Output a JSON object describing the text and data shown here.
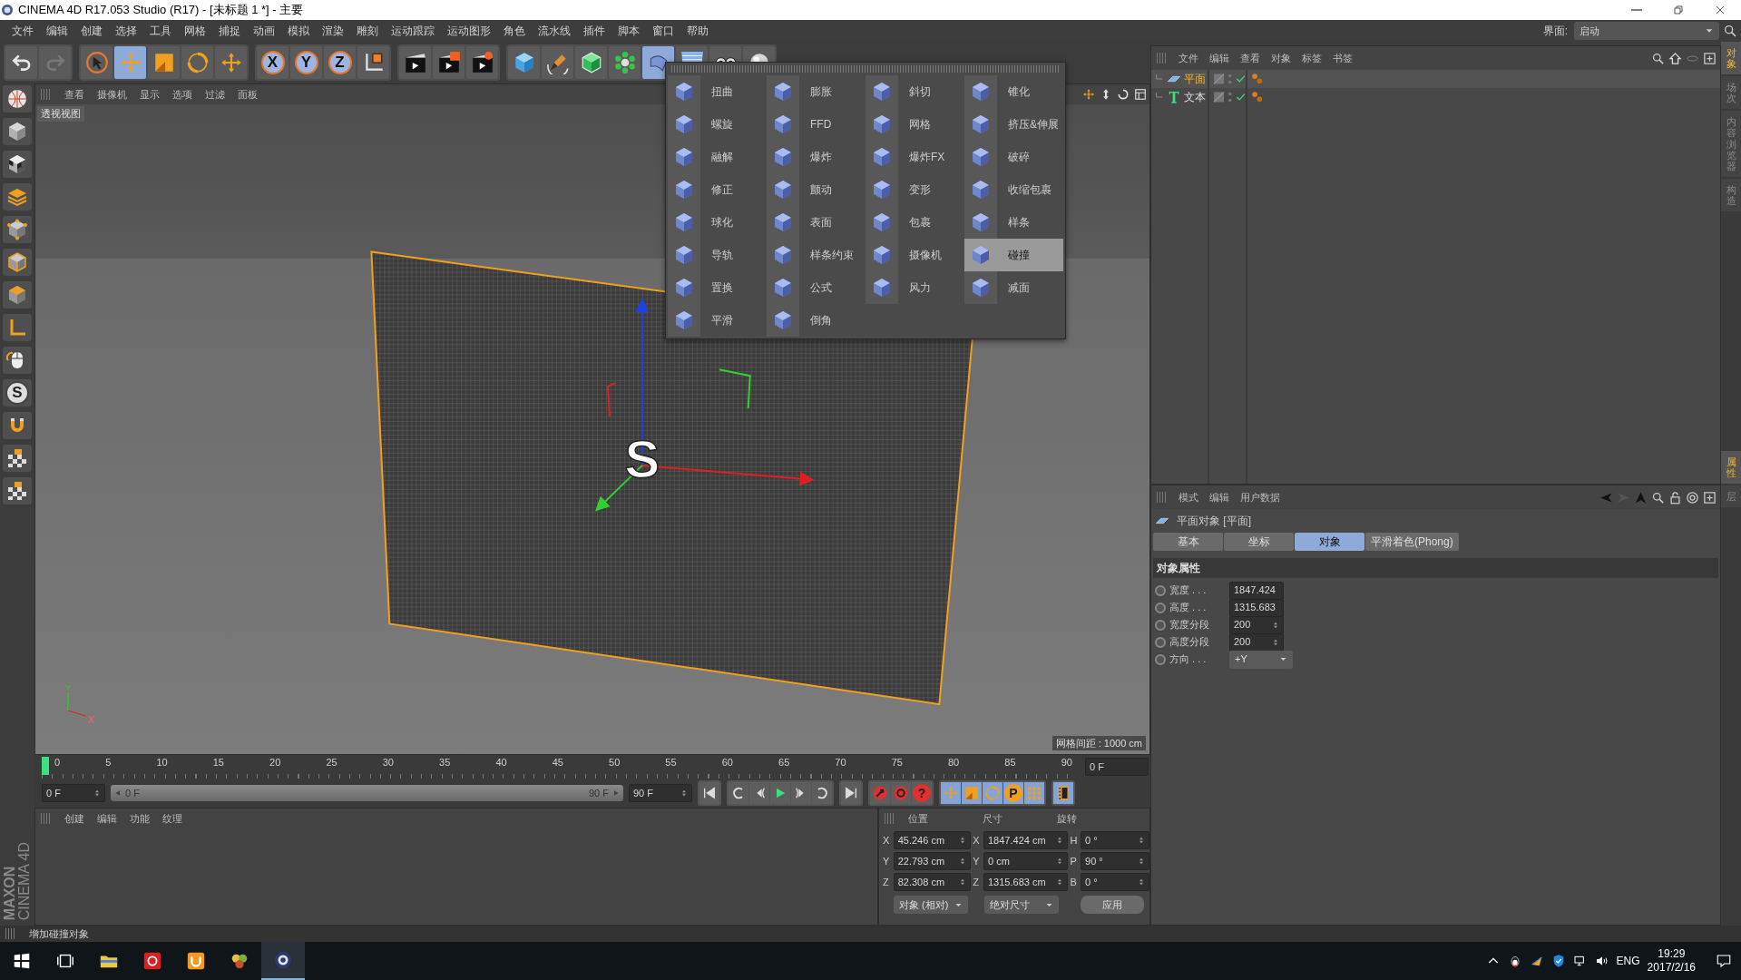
{
  "window": {
    "title": "CINEMA 4D R17.053 Studio (R17) - [未标题 1 *] - 主要"
  },
  "menu": [
    "文件",
    "编辑",
    "创建",
    "选择",
    "工具",
    "网格",
    "捕捉",
    "动画",
    "模拟",
    "渲染",
    "雕刻",
    "运动跟踪",
    "运动图形",
    "角色",
    "流水线",
    "插件",
    "脚本",
    "窗口",
    "帮助"
  ],
  "layout": {
    "label": "界面:",
    "value": "启动"
  },
  "toolbar": [
    [
      {
        "kind": "undo",
        "active": false
      },
      {
        "kind": "redo",
        "active": false
      }
    ],
    [
      {
        "kind": "select",
        "active": false
      },
      {
        "kind": "move",
        "active": true
      },
      {
        "kind": "scale",
        "active": false
      },
      {
        "kind": "rotate",
        "active": false
      },
      {
        "kind": "transform",
        "active": false
      }
    ],
    [
      {
        "kind": "axis",
        "label": "X",
        "active": false
      },
      {
        "kind": "axis",
        "label": "Y",
        "active": false
      },
      {
        "kind": "axis",
        "label": "Z",
        "active": false
      },
      {
        "kind": "coords",
        "active": false
      }
    ],
    [
      {
        "kind": "render_view",
        "active": false
      },
      {
        "kind": "render_picture",
        "active": false
      },
      {
        "kind": "render_settings",
        "active": false
      }
    ],
    [
      {
        "kind": "cube",
        "active": false
      },
      {
        "kind": "pen",
        "active": false
      },
      {
        "kind": "subdivision",
        "active": false
      },
      {
        "kind": "cloner",
        "active": false
      },
      {
        "kind": "deformer",
        "active": true
      },
      {
        "kind": "floor",
        "active": false
      },
      {
        "kind": "camera",
        "active": false
      },
      {
        "kind": "light",
        "active": false
      }
    ]
  ],
  "left_toolbar": [
    {
      "kind": "globe"
    },
    {
      "kind": "model"
    },
    {
      "kind": "texture"
    },
    {
      "kind": "workplane"
    },
    {
      "kind": "points"
    },
    {
      "kind": "edges"
    },
    {
      "kind": "polygons"
    },
    {
      "kind": "axis"
    },
    {
      "kind": "tweak"
    },
    {
      "kind": "snap",
      "label": "S"
    },
    {
      "kind": "magnet"
    },
    {
      "kind": "lock"
    },
    {
      "kind": "lock"
    }
  ],
  "logo": {
    "brand": "MAXON",
    "product": "CINEMA 4D"
  },
  "deformer_menu": {
    "columns": [
      [
        {
          "label": "扭曲",
          "selected": false
        },
        {
          "label": "螺旋",
          "selected": false
        },
        {
          "label": "融解",
          "selected": false
        },
        {
          "label": "修正",
          "selected": false
        },
        {
          "label": "球化",
          "selected": false
        },
        {
          "label": "导轨",
          "selected": false
        },
        {
          "label": "置换",
          "selected": false
        },
        {
          "label": "平滑",
          "selected": false
        }
      ],
      [
        {
          "label": "膨胀",
          "selected": false
        },
        {
          "label": "FFD",
          "selected": false
        },
        {
          "label": "爆炸",
          "selected": false
        },
        {
          "label": "颤动",
          "selected": false
        },
        {
          "label": "表面",
          "selected": false
        },
        {
          "label": "样条约束",
          "selected": false
        },
        {
          "label": "公式",
          "selected": false
        },
        {
          "label": "倒角",
          "selected": false
        }
      ],
      [
        {
          "label": "斜切",
          "selected": false
        },
        {
          "label": "网格",
          "selected": false
        },
        {
          "label": "爆炸FX",
          "selected": false
        },
        {
          "label": "变形",
          "selected": false
        },
        {
          "label": "包裹",
          "selected": false
        },
        {
          "label": "摄像机",
          "selected": false
        },
        {
          "label": "风力",
          "selected": false
        }
      ],
      [
        {
          "label": "锥化",
          "selected": false
        },
        {
          "label": "挤压&伸展",
          "selected": false
        },
        {
          "label": "破碎",
          "selected": false
        },
        {
          "label": "收缩包裹",
          "selected": false
        },
        {
          "label": "样条",
          "selected": false
        },
        {
          "label": "碰撞",
          "selected": true
        },
        {
          "label": "减面",
          "selected": false
        }
      ]
    ]
  },
  "viewport": {
    "menu": [
      "查看",
      "摄像机",
      "显示",
      "选项",
      "过滤",
      "面板"
    ],
    "view_name": "透视视图",
    "scene_text": "S",
    "axis_labels": [
      "Y",
      "X"
    ],
    "grid_info": "网格间距 : 1000 cm"
  },
  "timeline": {
    "ticks": [
      "0",
      "5",
      "10",
      "15",
      "20",
      "25",
      "30",
      "35",
      "40",
      "45",
      "50",
      "55",
      "60",
      "65",
      "70",
      "75",
      "80",
      "85",
      "90"
    ],
    "level": 0,
    "current_frame": "0 F",
    "start": "0 F",
    "range": {
      "start": "0 F",
      "end": "90 F",
      "level": 1
    },
    "end": "90 F"
  },
  "record_buttons": [
    {
      "kind": "key"
    },
    {
      "kind": "auto"
    },
    {
      "kind": "help",
      "label": "?"
    }
  ],
  "key_buttons": [
    {
      "kind": "move"
    },
    {
      "kind": "scale"
    },
    {
      "kind": "rotate"
    },
    {
      "kind": "param",
      "label": "P"
    },
    {
      "kind": "points"
    }
  ],
  "material_manager": {
    "menu": [
      "创建",
      "编辑",
      "功能",
      "纹理"
    ]
  },
  "coordinates": {
    "headers": [
      "位置",
      "尺寸",
      "旋转"
    ],
    "rows": [
      {
        "axis": "X",
        "position": "45.246 cm",
        "size_axis": "X",
        "size": "1847.424 cm",
        "angle": "H",
        "rotation": "0 °"
      },
      {
        "axis": "Y",
        "position": "22.793 cm",
        "size_axis": "Y",
        "size": "0 cm",
        "angle": "P",
        "rotation": "90 °"
      },
      {
        "axis": "Z",
        "position": "82.308 cm",
        "size_axis": "Z",
        "size": "1315.683 cm",
        "angle": "B",
        "rotation": "0 °"
      }
    ],
    "mode": "对象 (相对)",
    "size_mode": "绝对尺寸",
    "apply": "应用"
  },
  "object_manager": {
    "menu": [
      "文件",
      "编辑",
      "查看",
      "对象",
      "标签",
      "书签"
    ],
    "objects": [
      {
        "name": "平面",
        "kind": "plane",
        "selected": true
      },
      {
        "name": "文本",
        "kind": "text",
        "selected": false
      }
    ]
  },
  "attributes": {
    "menu": [
      "模式",
      "编辑",
      "用户数据"
    ],
    "title": "平面对象 [平面]",
    "tabs": [
      {
        "label": "基本",
        "selected": false
      },
      {
        "label": "坐标",
        "selected": false
      },
      {
        "label": "对象",
        "selected": true
      },
      {
        "label": "平滑着色(Phong)",
        "selected": false
      }
    ],
    "section": "对象属性",
    "fields": [
      {
        "label": "宽度 . . .",
        "value": "1847.424",
        "kind": "number",
        "checked": false
      },
      {
        "label": "高度 . . .",
        "value": "1315.683",
        "kind": "number",
        "checked": false
      },
      {
        "label": "宽度分段",
        "value": "200",
        "kind": "number",
        "checked": false
      },
      {
        "label": "高度分段",
        "value": "200",
        "kind": "number",
        "checked": false
      },
      {
        "label": "方向 . . .",
        "value": "+Y",
        "kind": "dropdown",
        "checked": false
      }
    ]
  },
  "side_tabs_top": [
    {
      "label": "对象",
      "selected": true
    },
    {
      "label": "场次",
      "selected": false
    },
    {
      "label": "内容浏览器",
      "selected": false
    },
    {
      "label": "构造",
      "selected": false
    }
  ],
  "side_tabs_bottom": [
    {
      "label": "属性",
      "selected": true
    },
    {
      "label": "层",
      "selected": false
    }
  ],
  "status_bar": {
    "text": "增加碰撞对象"
  },
  "taskbar": {
    "apps": [
      {
        "kind": "start",
        "selected": false
      },
      {
        "kind": "taskview",
        "selected": false
      },
      {
        "kind": "explorer",
        "selected": false
      },
      {
        "kind": "music",
        "selected": false
      },
      {
        "kind": "browser",
        "selected": false
      },
      {
        "kind": "game",
        "selected": false
      },
      {
        "kind": "cinema",
        "selected": true
      }
    ],
    "language": "ENG",
    "time": "19:29",
    "date": "2017/2/16"
  }
}
